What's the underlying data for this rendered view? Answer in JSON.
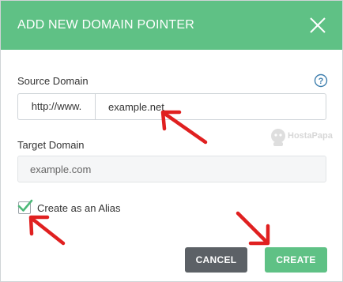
{
  "dialog": {
    "title": "ADD NEW DOMAIN POINTER",
    "close_icon": "close-x-icon"
  },
  "source_domain": {
    "label": "Source Domain",
    "help_icon": "question-circle-icon",
    "prefix": "http://www.",
    "value": "example.net"
  },
  "target_domain": {
    "label": "Target Domain",
    "placeholder": "example.com"
  },
  "alias": {
    "label": "Create as an Alias",
    "checked": true
  },
  "buttons": {
    "cancel": "CANCEL",
    "create": "CREATE"
  },
  "watermark": {
    "text": "HostaPapa"
  },
  "colors": {
    "header": "#5fc185",
    "create_button": "#5fc185",
    "cancel_button": "#5c6166",
    "annotation_arrow": "#e02020"
  }
}
